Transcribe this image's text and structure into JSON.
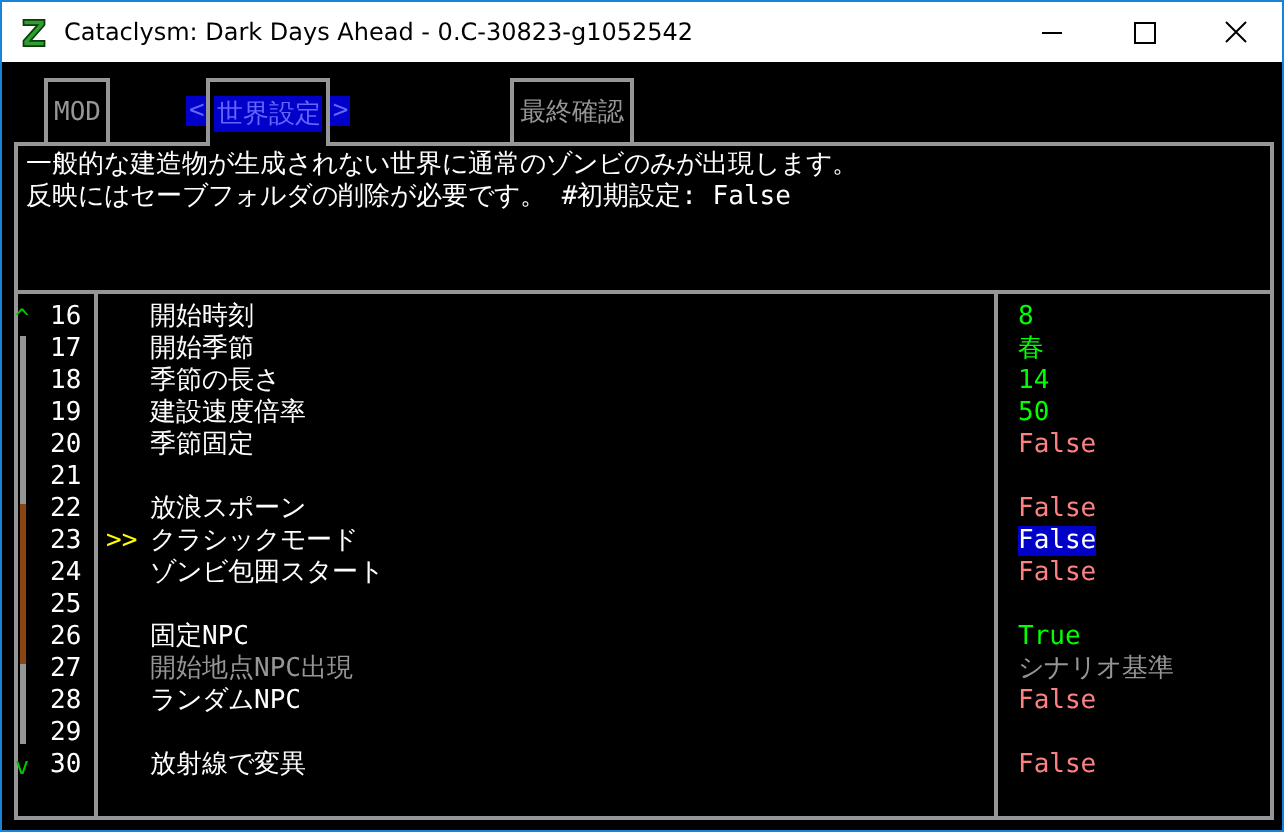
{
  "window": {
    "title": "Cataclysm: Dark Days Ahead - 0.C-30823-g1052542"
  },
  "tabs": {
    "items": [
      {
        "label": "MOD",
        "selected": false
      },
      {
        "label": "世界設定",
        "selected": true
      },
      {
        "label": "最終確認",
        "selected": false
      }
    ],
    "prev_mark": "<",
    "next_mark": ">"
  },
  "description": [
    "一般的な建造物が生成されない世界に通常のゾンビのみが出現します。",
    "反映にはセーブフォルダの削除が必要です。 #初期設定: False"
  ],
  "scrollbar": {
    "up": "^",
    "down": "v"
  },
  "cursor": ">>",
  "options": [
    {
      "number": "16",
      "label": "開始時刻",
      "value": "8",
      "color": "#00ff00",
      "selected": false,
      "disabled": false
    },
    {
      "number": "17",
      "label": "開始季節",
      "value": "春",
      "color": "#00ff00",
      "selected": false,
      "disabled": false
    },
    {
      "number": "18",
      "label": "季節の長さ",
      "value": "14",
      "color": "#00ff00",
      "selected": false,
      "disabled": false
    },
    {
      "number": "19",
      "label": "建設速度倍率",
      "value": "50",
      "color": "#00ff00",
      "selected": false,
      "disabled": false
    },
    {
      "number": "20",
      "label": "季節固定",
      "value": "False",
      "color": "#ff8080",
      "selected": false,
      "disabled": false
    },
    {
      "number": "21"
    },
    {
      "number": "22",
      "label": "放浪スポーン",
      "value": "False",
      "color": "#ff8080",
      "selected": false,
      "disabled": false
    },
    {
      "number": "23",
      "label": "クラシックモード",
      "value": "False",
      "selected": true,
      "disabled": false
    },
    {
      "number": "24",
      "label": "ゾンビ包囲スタート",
      "value": "False",
      "color": "#ff8080",
      "selected": false,
      "disabled": false
    },
    {
      "number": "25"
    },
    {
      "number": "26",
      "label": "固定NPC",
      "value": "True",
      "color": "#00ff00",
      "selected": false,
      "disabled": false
    },
    {
      "number": "27",
      "label": "開始地点NPC出現",
      "value": "シナリオ基準",
      "color": "#969696",
      "selected": false,
      "disabled": true
    },
    {
      "number": "28",
      "label": "ランダムNPC",
      "value": "False",
      "color": "#ff8080",
      "selected": false,
      "disabled": false
    },
    {
      "number": "29"
    },
    {
      "number": "30",
      "label": "放射線で変異",
      "value": "False",
      "color": "#ff8080",
      "selected": false,
      "disabled": false
    }
  ]
}
